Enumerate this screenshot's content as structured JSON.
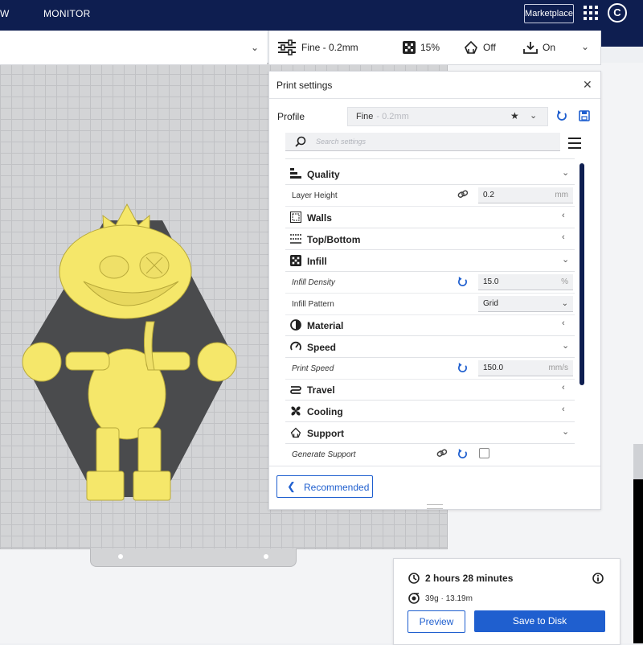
{
  "header": {
    "stage_prepare_fragment": "W",
    "stage_monitor": "MONITOR",
    "marketplace_label": "Marketplace",
    "account_initial": "C"
  },
  "printbar": {
    "profile": "Fine - 0.2mm",
    "infill": "15%",
    "support": "Off",
    "adhesion": "On"
  },
  "panel": {
    "title": "Print settings",
    "profile_label": "Profile",
    "profile_value": "Fine",
    "profile_suffix": "- 0.2mm",
    "search_placeholder": "Search settings",
    "recommended_label": "Recommended",
    "categories": {
      "quality": "Quality",
      "walls": "Walls",
      "topbottom": "Top/Bottom",
      "infill": "Infill",
      "material": "Material",
      "speed": "Speed",
      "travel": "Travel",
      "cooling": "Cooling",
      "support": "Support"
    },
    "settings": {
      "layer_height_label": "Layer Height",
      "layer_height_value": "0.2",
      "layer_height_unit": "mm",
      "infill_density_label": "Infill Density",
      "infill_density_value": "15.0",
      "infill_density_unit": "%",
      "infill_pattern_label": "Infill Pattern",
      "infill_pattern_value": "Grid",
      "print_speed_label": "Print Speed",
      "print_speed_value": "150.0",
      "print_speed_unit": "mm/s",
      "generate_support_label": "Generate Support",
      "generate_support_checked": false
    }
  },
  "action": {
    "print_time": "2 hours 28 minutes",
    "material_estimate": "39g · 13.19m",
    "preview_label": "Preview",
    "save_label": "Save to Disk"
  },
  "colors": {
    "header_bg": "#0e1e50",
    "accent": "#1f5fcf",
    "model_yellow": "#f5e76a",
    "bed_gray": "#d3d4d6"
  }
}
